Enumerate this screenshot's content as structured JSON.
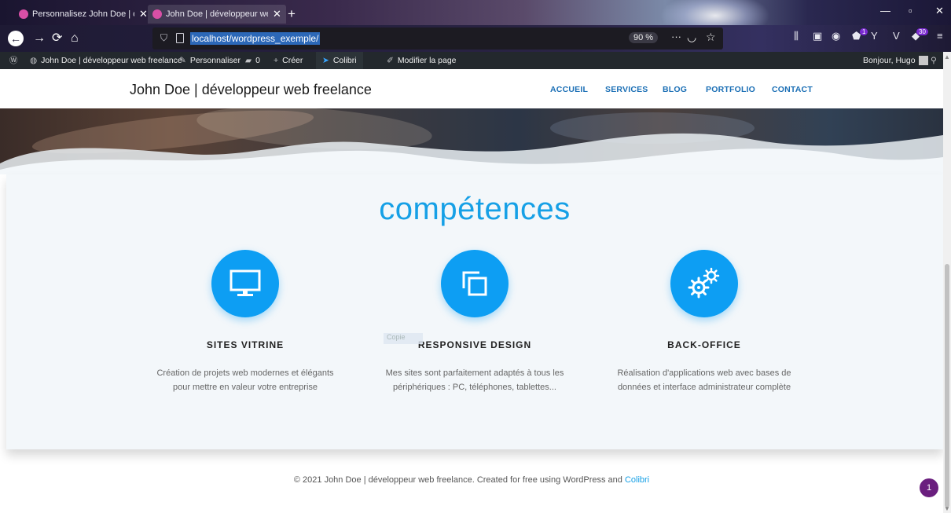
{
  "browser": {
    "tabs": [
      {
        "title": "Personnalisez John Doe | dévelo",
        "active": false
      },
      {
        "title": "John Doe | développeur web fr",
        "active": true
      }
    ],
    "new_tab": "+",
    "url": "localhost/wordpress_exemple/",
    "zoom": "90 %",
    "toolbar_badges": {
      "shield": "1",
      "ext": "30"
    }
  },
  "wp_admin_bar": {
    "site_name": "John Doe | développeur web freelance",
    "customize": "Personnaliser",
    "comments": "0",
    "create": "Créer",
    "colibri": "Colibri",
    "edit_page": "Modifier la page",
    "greeting": "Bonjour, Hugo"
  },
  "header": {
    "site_title": "John Doe | développeur web freelance",
    "menu": [
      "ACCUEIL",
      "SERVICES",
      "BLOG",
      "PORTFOLIO",
      "CONTACT"
    ]
  },
  "skills": {
    "heading": "compétences",
    "cards": [
      {
        "title": "SITES VITRINE",
        "text_line1": "Création de projets web modernes et élégants",
        "text_line2": "pour mettre en valeur votre entreprise",
        "icon": "monitor-icon"
      },
      {
        "title": "RESPONSIVE DESIGN",
        "text_line1": "Mes sites sont parfaitement adaptés à tous les",
        "text_line2": "périphériques : PC, téléphones, tablettes...",
        "icon": "copy-icon"
      },
      {
        "title": "BACK-OFFICE",
        "text_line1": "Réalisation d'applications web avec bases de",
        "text_line2": "données et interface administrateur complète",
        "icon": "gears-icon"
      }
    ],
    "ghost_label": "Copie"
  },
  "footer": {
    "text": "© 2021 John Doe | développeur web freelance. Created for free using WordPress and ",
    "link": "Colibri"
  },
  "notification_count": "1",
  "colors": {
    "accent": "#16a0e6",
    "icon_circle": "#0d9ef3",
    "menu": "#1b6fb5",
    "admin_bar": "#23282d",
    "notif": "#6a1e7e"
  }
}
